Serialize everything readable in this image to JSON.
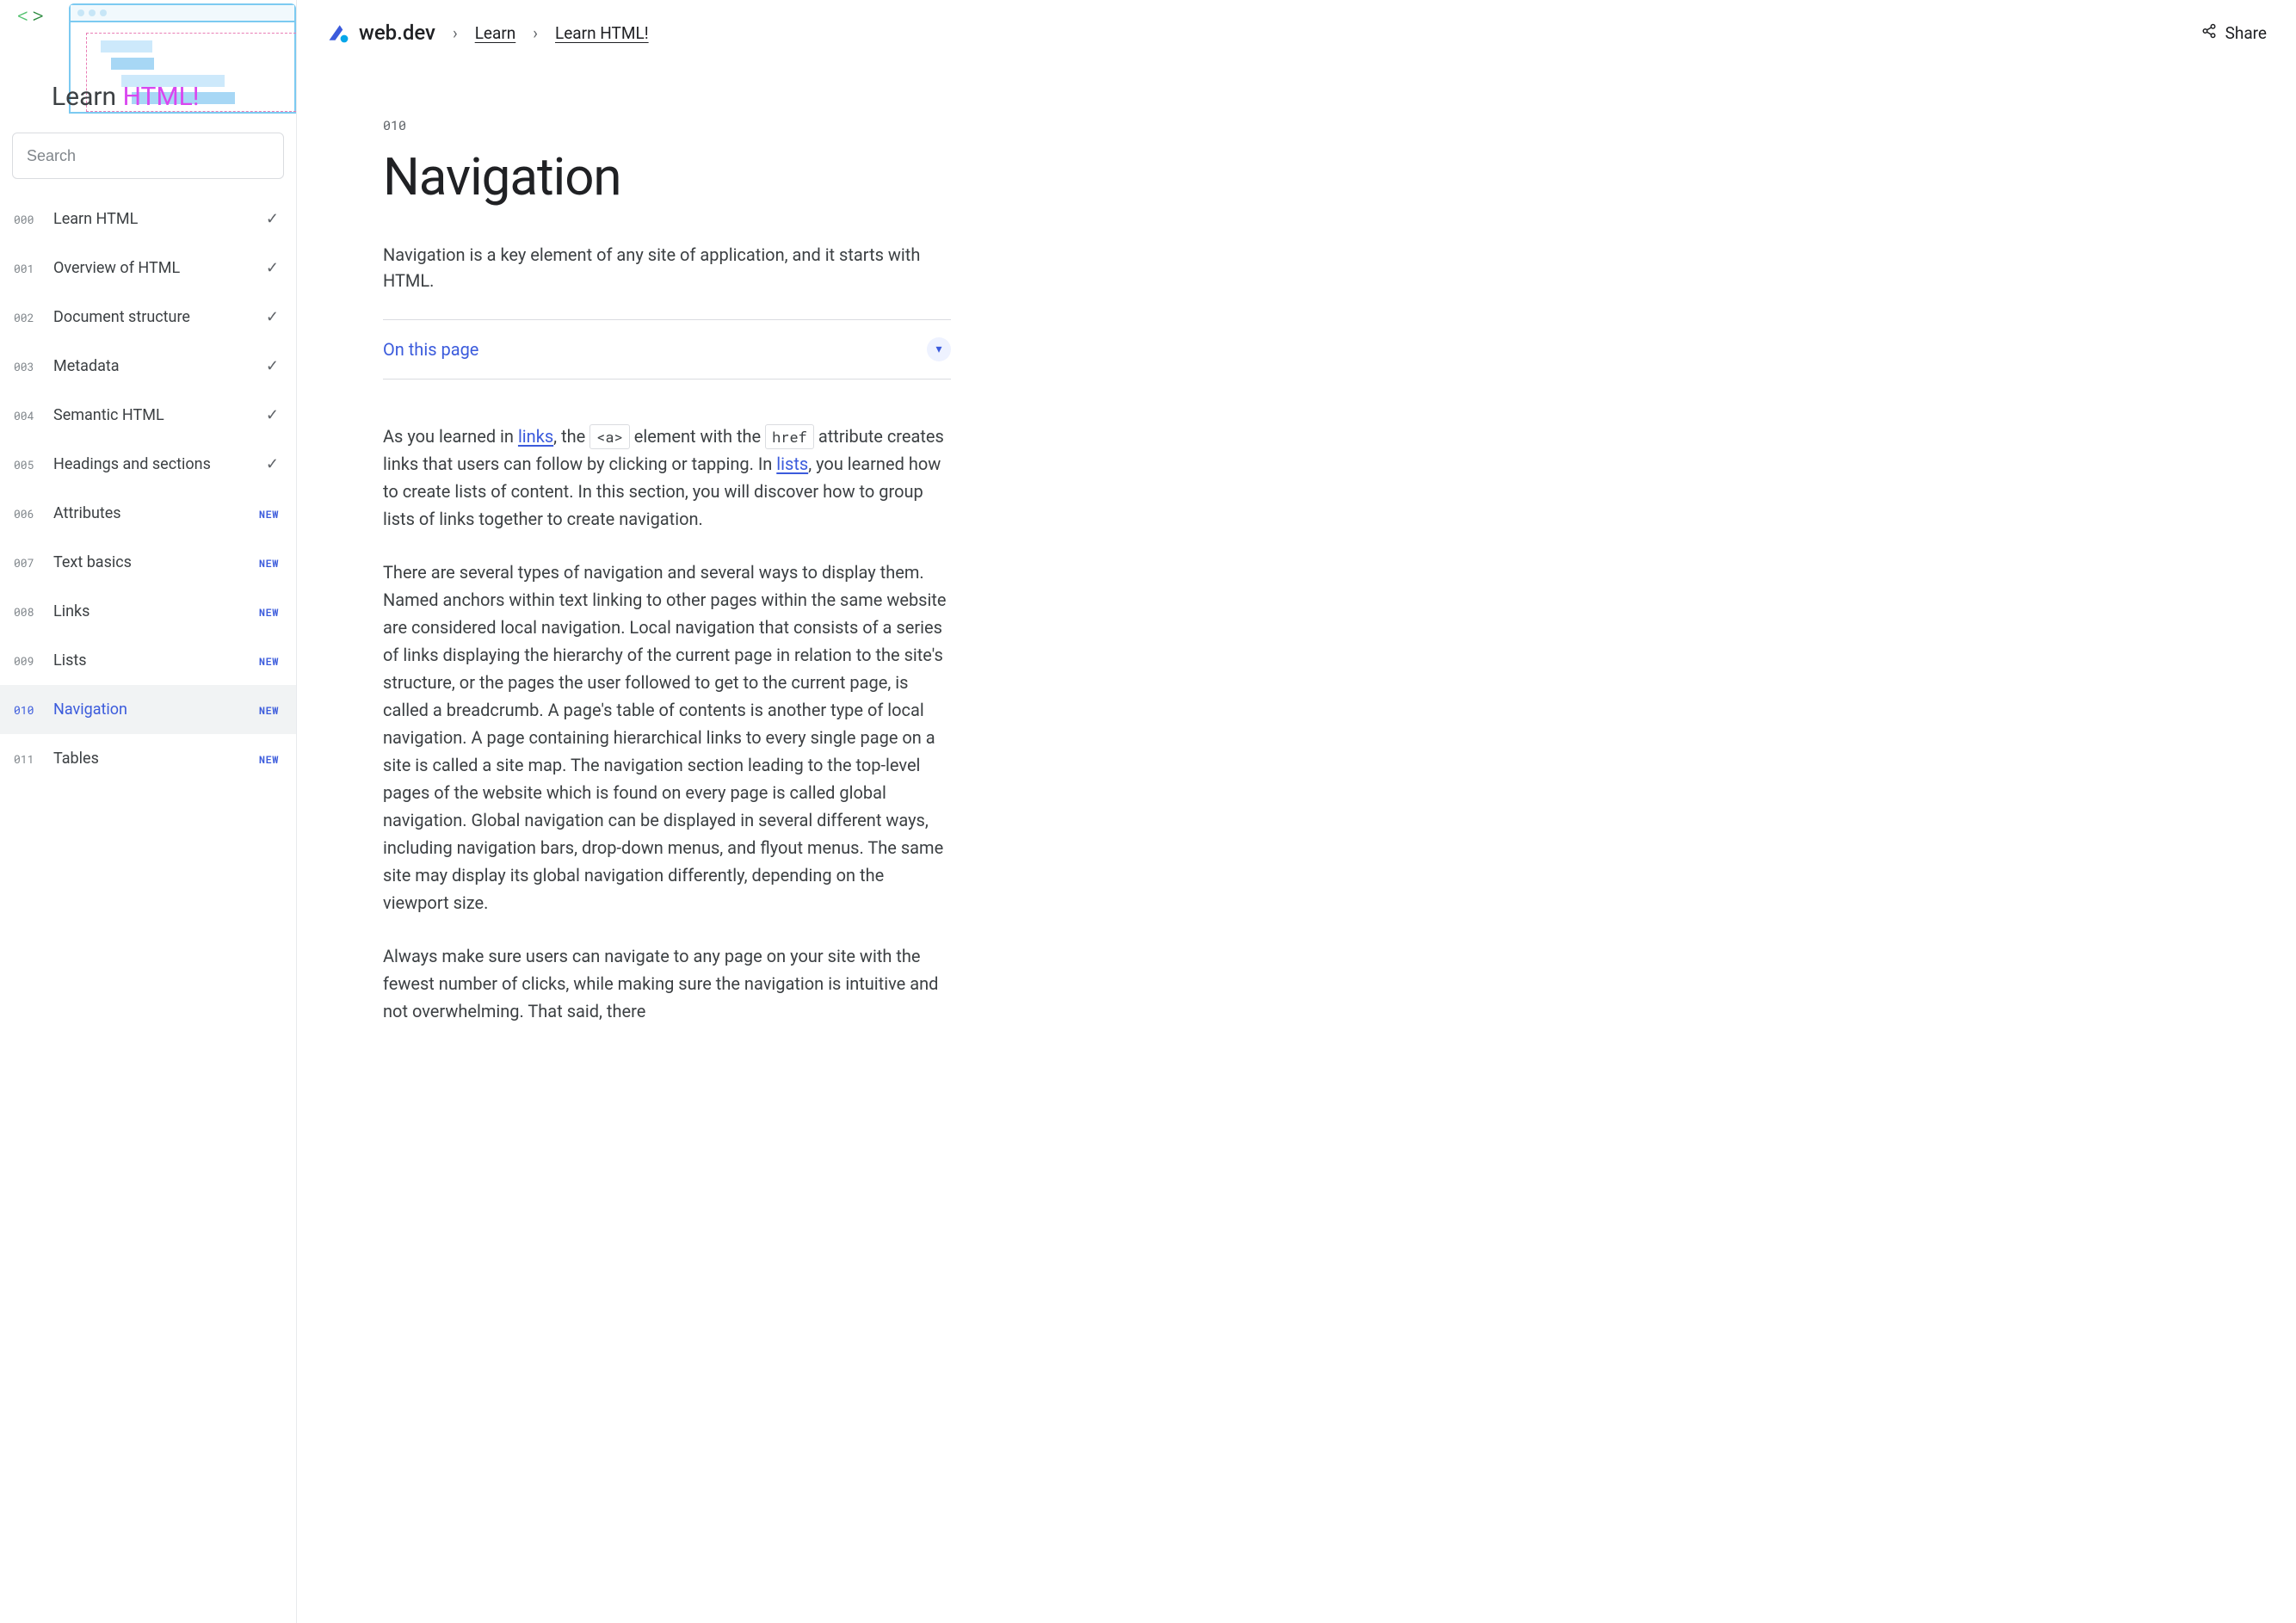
{
  "hero": {
    "title_learn": "Learn",
    "title_html": "HTML!"
  },
  "search": {
    "placeholder": "Search"
  },
  "sidebar": {
    "items": [
      {
        "num": "000",
        "label": "Learn HTML",
        "status": "check"
      },
      {
        "num": "001",
        "label": "Overview of HTML",
        "status": "check"
      },
      {
        "num": "002",
        "label": "Document structure",
        "status": "check"
      },
      {
        "num": "003",
        "label": "Metadata",
        "status": "check"
      },
      {
        "num": "004",
        "label": "Semantic HTML",
        "status": "check"
      },
      {
        "num": "005",
        "label": "Headings and sections",
        "status": "check"
      },
      {
        "num": "006",
        "label": "Attributes",
        "status": "new"
      },
      {
        "num": "007",
        "label": "Text basics",
        "status": "new"
      },
      {
        "num": "008",
        "label": "Links",
        "status": "new"
      },
      {
        "num": "009",
        "label": "Lists",
        "status": "new"
      },
      {
        "num": "010",
        "label": "Navigation",
        "status": "new",
        "active": true
      },
      {
        "num": "011",
        "label": "Tables",
        "status": "new"
      }
    ],
    "new_label": "NEW"
  },
  "topbar": {
    "brand": "web.dev",
    "crumbs": [
      "Learn",
      "Learn HTML!"
    ],
    "share": "Share"
  },
  "article": {
    "num": "010",
    "title": "Navigation",
    "lede": "Navigation is a key element of any site of application, and it starts with HTML.",
    "toc_label": "On this page",
    "p1_a": "As you learned in ",
    "p1_link1": "links",
    "p1_b": ", the ",
    "p1_code1": "<a>",
    "p1_c": " element with the ",
    "p1_code2": "href",
    "p1_d": " attribute creates links that users can follow by clicking or tapping. In ",
    "p1_link2": "lists",
    "p1_e": ", you learned how to create lists of content. In this section, you will discover how to group lists of links together to create navigation.",
    "p2": "There are several types of navigation and several ways to display them. Named anchors within text linking to other pages within the same website are considered local navigation. Local navigation that consists of a series of links displaying the hierarchy of the current page in relation to the site's structure, or the pages the user followed to get to the current page, is called a breadcrumb. A page's table of contents is another type of local navigation. A page containing hierarchical links to every single page on a site is called a site map. The navigation section leading to the top-level pages of the website which is found on every page is called global navigation. Global navigation can be displayed in several different ways, including navigation bars, drop-down menus, and flyout menus. The same site may display its global navigation differently, depending on the viewport size.",
    "p3": "Always make sure users can navigate to any page on your site with the fewest number of clicks, while making sure the navigation is intuitive and not overwhelming. That said, there"
  }
}
